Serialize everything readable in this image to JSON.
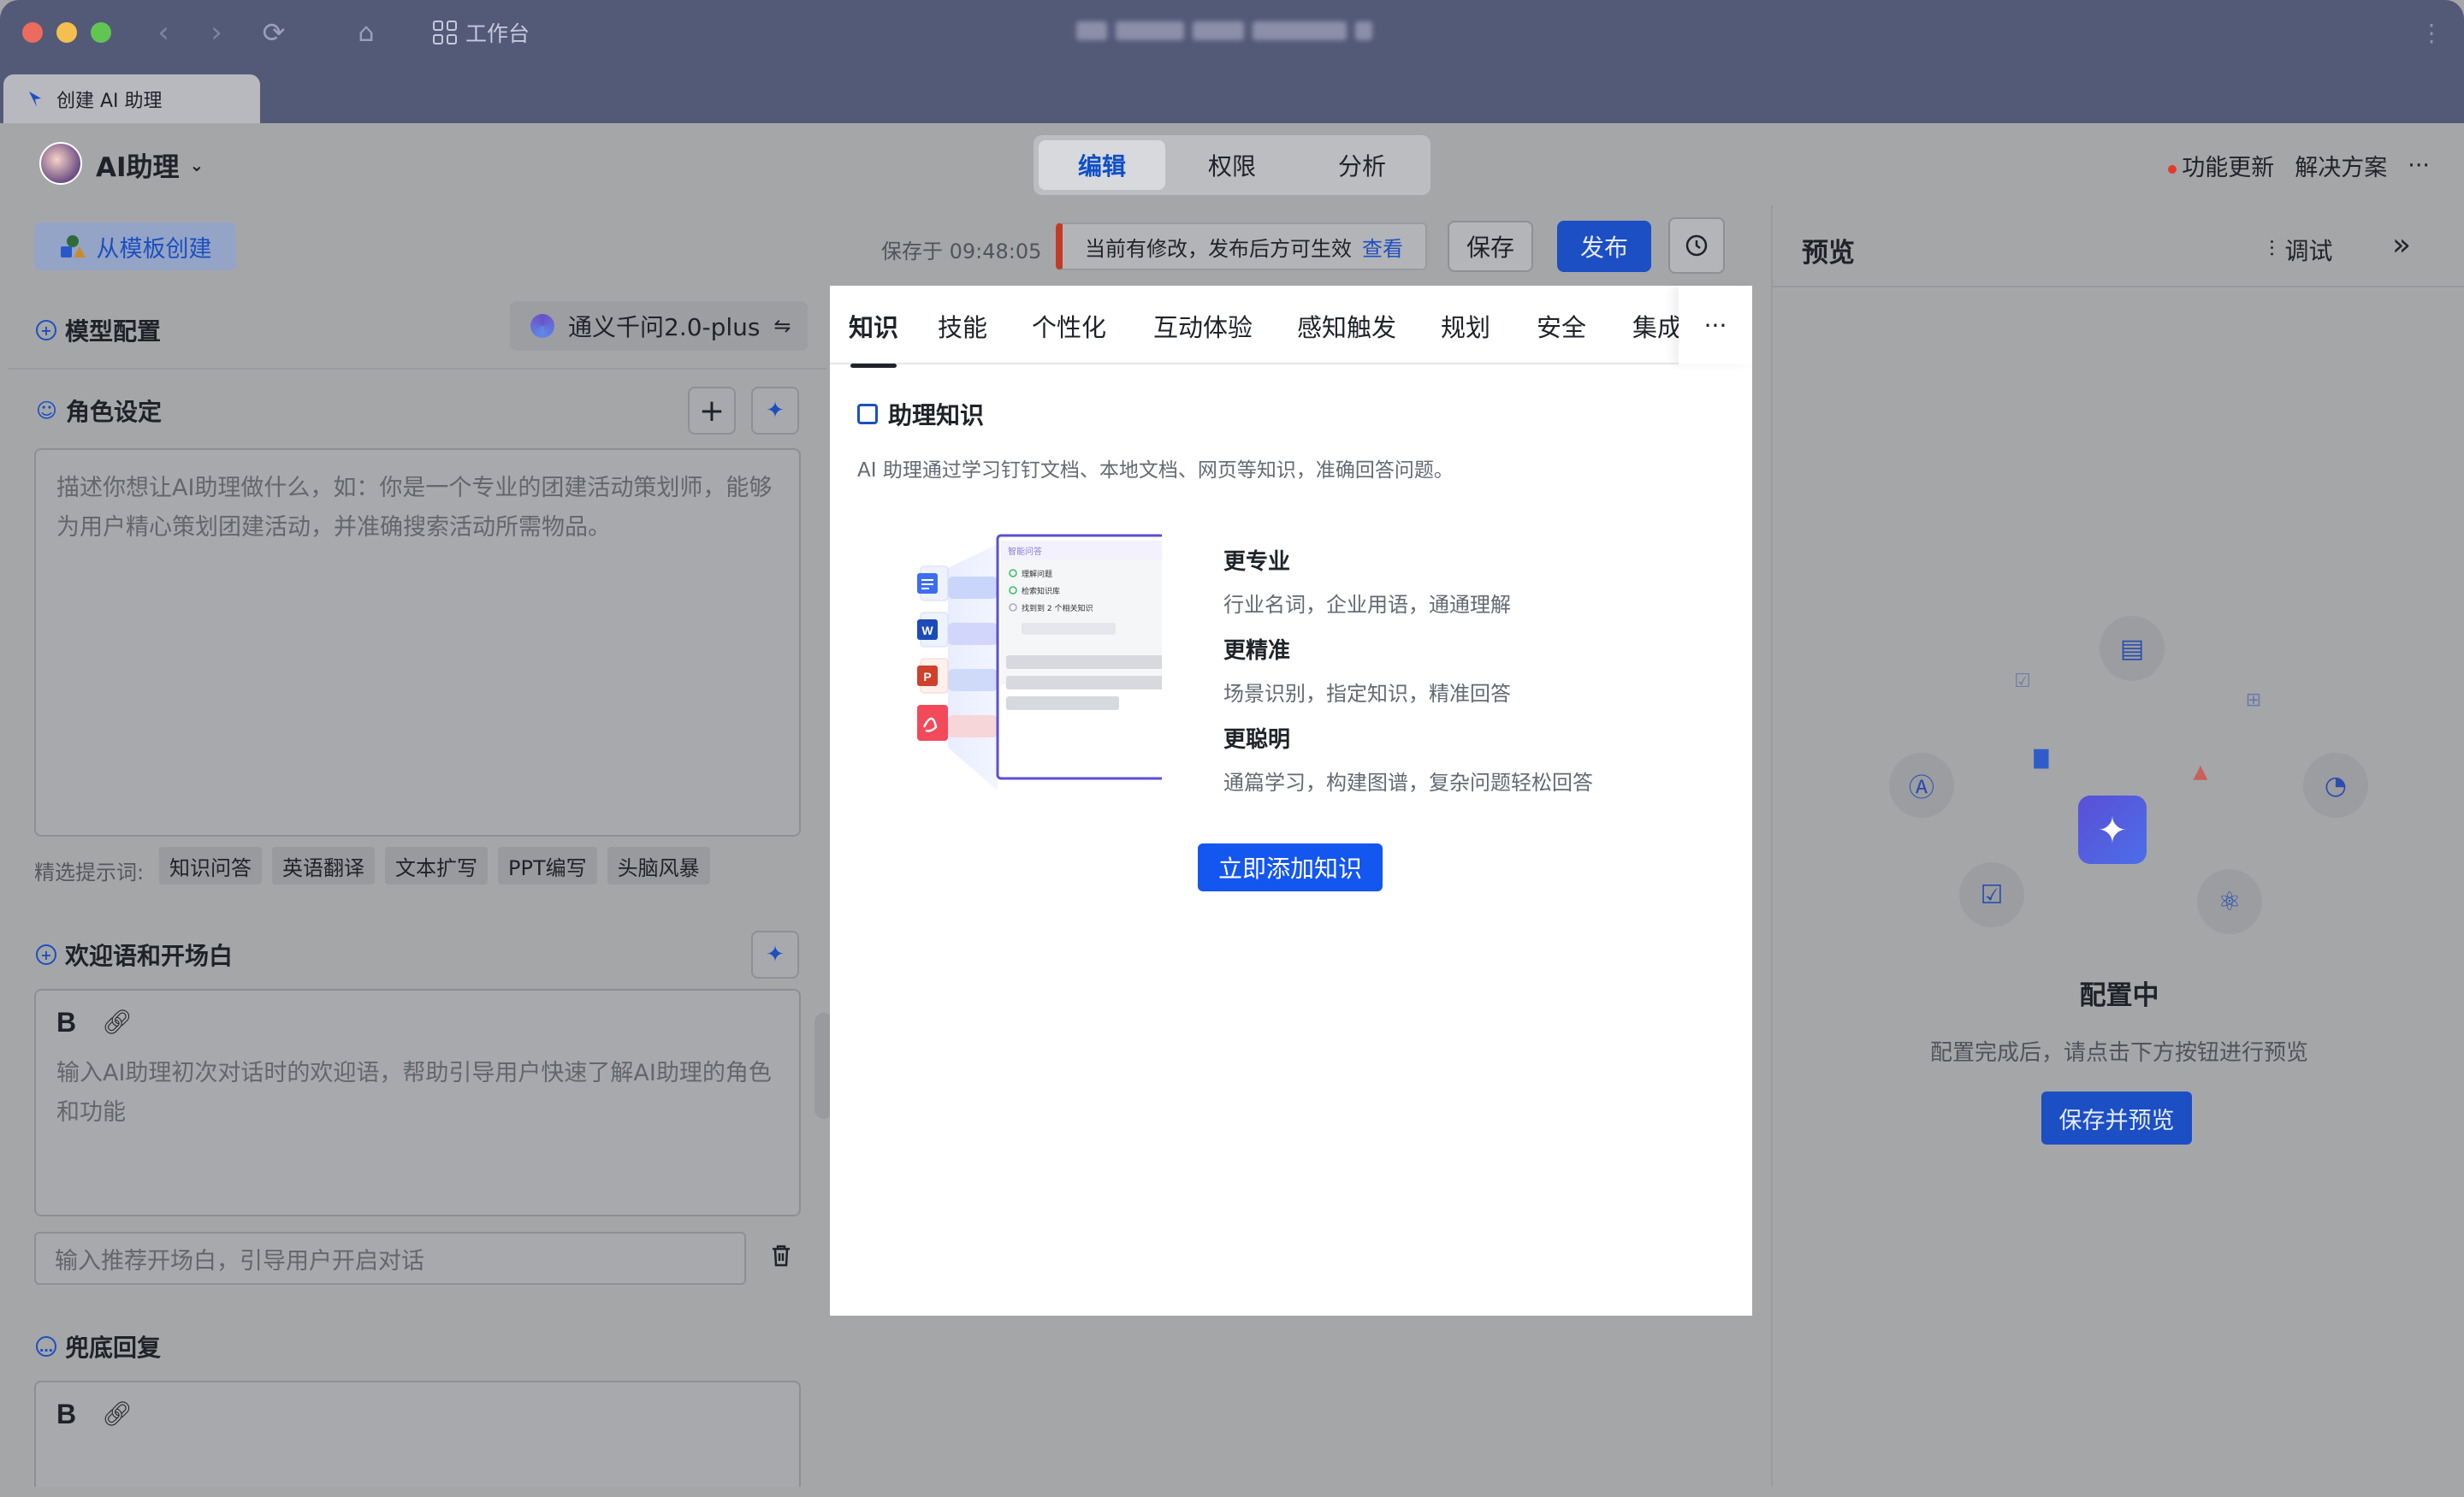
{
  "window": {
    "workbench_label": "工作台",
    "tab_title": "创建 AI 助理"
  },
  "header": {
    "app_name": "AI助理",
    "mode_tabs": [
      "编辑",
      "权限",
      "分析"
    ],
    "feature_update": "功能更新",
    "solutions": "解决方案",
    "more": "···"
  },
  "toolbar": {
    "template_btn": "从模板创建",
    "saved_at": "保存于 09:48:05",
    "notice_text": "当前有修改，发布后方可生效",
    "notice_link": "查看",
    "save_label": "保存",
    "publish_label": "发布"
  },
  "left": {
    "model_config": "模型配置",
    "model_name": "通义千问2.0-plus",
    "role_title": "角色设定",
    "role_placeholder": "描述你想让AI助理做什么，如：你是一个专业的团建活动策划师，能够为用户精心策划团建活动，并准确搜索活动所需物品。",
    "chips_label": "精选提示词:",
    "chips": [
      "知识问答",
      "英语翻译",
      "文本扩写",
      "PPT编写",
      "头脑风暴"
    ],
    "welcome_title": "欢迎语和开场白",
    "welcome_placeholder": "输入AI助理初次对话时的欢迎语，帮助引导用户快速了解AI助理的角色和功能",
    "opener_placeholder": "输入推荐开场白，引导用户开启对话",
    "fallback_title": "兜底回复",
    "bold_label": "B"
  },
  "middle": {
    "tabs": [
      "知识",
      "技能",
      "个性化",
      "互动体验",
      "感知触发",
      "规划",
      "安全",
      "集成"
    ],
    "more": "···",
    "kn_title": "助理知识",
    "kn_desc": "AI 助理通过学习钉钉文档、本地文档、网页等知识，准确回答问题。",
    "features": [
      {
        "title": "更专业",
        "desc": "行业名词，企业用语，通通理解"
      },
      {
        "title": "更精准",
        "desc": "场景识别，指定知识，精准回答"
      },
      {
        "title": "更聪明",
        "desc": "通篇学习，构建图谱，复杂问题轻松回答"
      }
    ],
    "add_btn": "立即添加知识",
    "illus": {
      "header": "智能问答",
      "step1": "理解问题",
      "step2": "检索知识库",
      "step3": "找到到 2 个相关知识"
    }
  },
  "right": {
    "title": "预览",
    "debug": "调试",
    "status_title": "配置中",
    "status_desc": "配置完成后，请点击下方按钮进行预览",
    "save_preview": "保存并预览"
  },
  "colors": {
    "primary": "#1456f0",
    "titlebar": "#535a78",
    "overlay": "#a5a6a8",
    "alert": "#c23a26"
  }
}
